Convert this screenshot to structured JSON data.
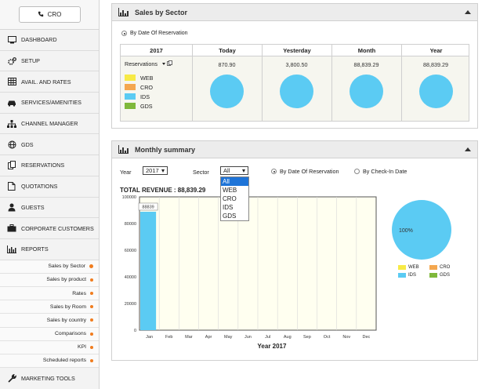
{
  "sidebar": {
    "cro_button": "CRO",
    "items": [
      {
        "label": "DASHBOARD",
        "icon": "monitor-icon"
      },
      {
        "label": "SETUP",
        "icon": "gears-icon"
      },
      {
        "label": "AVAIL. AND RATES",
        "icon": "grid-icon"
      },
      {
        "label": "SERVICES/AMENITIES",
        "icon": "car-icon"
      },
      {
        "label": "CHANNEL MANAGER",
        "icon": "sitemap-icon"
      },
      {
        "label": "GDS",
        "icon": "globe-icon"
      },
      {
        "label": "RESERVATIONS",
        "icon": "copy-icon"
      },
      {
        "label": "QUOTATIONS",
        "icon": "file-icon"
      },
      {
        "label": "GUESTS",
        "icon": "user-icon"
      },
      {
        "label": "CORPORATE CUSTOMERS",
        "icon": "briefcase-icon"
      },
      {
        "label": "REPORTS",
        "icon": "bar-chart-icon"
      }
    ],
    "sub_items": [
      "Sales by Sector",
      "Sales by product",
      "Rates",
      "Sales by Room",
      "Sales by country",
      "Comparisons",
      "KPI",
      "Scheduled reports"
    ],
    "bottom_item": {
      "label": "MARKETING TOOLS",
      "icon": "wrench-icon"
    }
  },
  "sector_panel": {
    "title": "Sales by Sector",
    "radio_label": "By Date Of Reservation",
    "year_header": "2017",
    "columns": [
      "Today",
      "Yesterday",
      "Month",
      "Year"
    ],
    "row_label": "Reservations",
    "values": [
      "870.90",
      "3,800.50",
      "88,839.29",
      "88,839.29"
    ],
    "legend": [
      {
        "name": "WEB",
        "color": "#f7ea46"
      },
      {
        "name": "CRO",
        "color": "#f4a74f"
      },
      {
        "name": "IDS",
        "color": "#5bcbf3"
      },
      {
        "name": "GDS",
        "color": "#7fb83b"
      }
    ]
  },
  "monthly_panel": {
    "title": "Monthly summary",
    "year_label": "Year",
    "year_value": "2017",
    "sector_label": "Sector",
    "sector_value": "All",
    "sector_options": [
      "All",
      "WEB",
      "CRO",
      "IDS",
      "GDS"
    ],
    "radio_reservation": "By Date Of Reservation",
    "radio_checkin": "By Check-In Date",
    "total_revenue": "TOTAL REVENUE : 88,839.29",
    "pie_label": "100%",
    "pie_legend": [
      {
        "name": "WEB",
        "color": "#f7ea46"
      },
      {
        "name": "CRO",
        "color": "#f4a74f"
      },
      {
        "name": "IDS",
        "color": "#5bcbf3"
      },
      {
        "name": "GDS",
        "color": "#7fb83b"
      }
    ]
  },
  "chart_data": {
    "type": "bar",
    "categories": [
      "Jan",
      "Feb",
      "Mar",
      "Apr",
      "May",
      "Jun",
      "Jul",
      "Aug",
      "Sep",
      "Oct",
      "Nov",
      "Dec"
    ],
    "values": [
      88839,
      0,
      0,
      0,
      0,
      0,
      0,
      0,
      0,
      0,
      0,
      0
    ],
    "bar_label": "88839",
    "xlabel": "Year 2017",
    "ylim": [
      0,
      100000
    ],
    "yticks": [
      "0",
      "20000",
      "40000",
      "60000",
      "80000",
      "100000"
    ],
    "bar_color": "#5bcbf3",
    "background": "#fffff0",
    "grid": true
  }
}
